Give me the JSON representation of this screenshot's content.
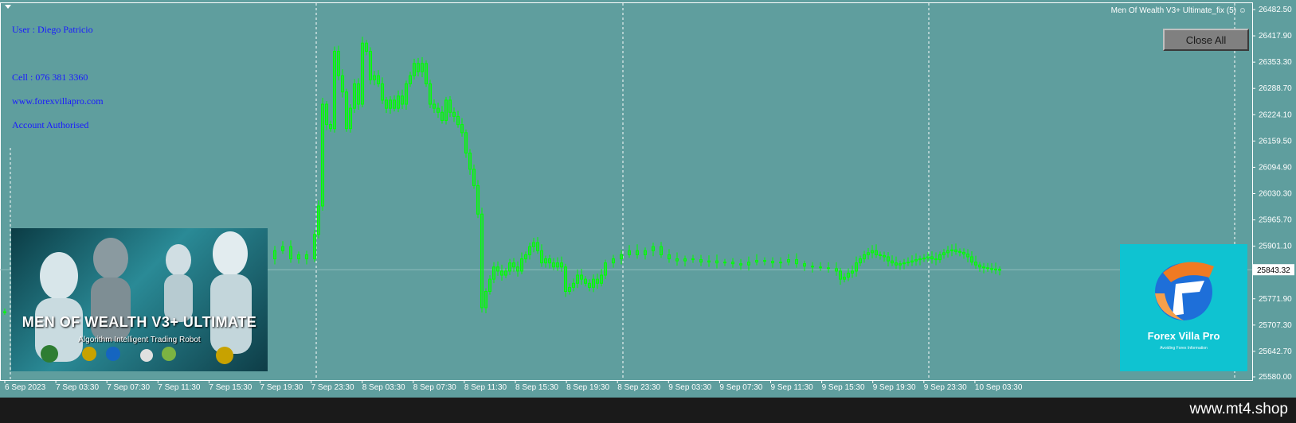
{
  "chart": {
    "ea_name": "Men Of Wealth V3+ Ultimate_fix (5)",
    "close_all_label": "Close All",
    "current_price_label": "25843.32",
    "price_labels": [
      "26482.50",
      "26417.90",
      "26353.30",
      "26288.70",
      "26224.10",
      "26159.50",
      "26094.90",
      "26030.30",
      "25965.70",
      "25901.10",
      "25771.90",
      "25707.30",
      "25642.70",
      "25580.00"
    ],
    "time_labels": [
      "6 Sep 2023",
      "7 Sep 03:30",
      "7 Sep 07:30",
      "7 Sep 11:30",
      "7 Sep 15:30",
      "7 Sep 19:30",
      "7 Sep 23:30",
      "8 Sep 03:30",
      "8 Sep 07:30",
      "8 Sep 11:30",
      "8 Sep 15:30",
      "8 Sep 19:30",
      "8 Sep 23:30",
      "9 Sep 03:30",
      "9 Sep 07:30",
      "9 Sep 11:30",
      "9 Sep 15:30",
      "9 Sep 19:30",
      "9 Sep 23:30",
      "10 Sep 03:30"
    ],
    "colors": {
      "background": "#5f9e9e",
      "candle": "#00ff00",
      "text": "#ffffff",
      "info_text": "#1a1aff"
    }
  },
  "info": {
    "user": "User : Diego Patricio",
    "cell": "Cell : 076 381 3360",
    "website": "www.forexvillapro.com",
    "account": "Account Authorised"
  },
  "banner": {
    "title": "MEN OF WEALTH V3+ ULTIMATE",
    "subtitle": "Algorithm Intelligent Trading Robot"
  },
  "logo": {
    "name": "Forex Villa Pro",
    "tagline": "Avoiding Forex Information"
  },
  "watermark": "www.mt4.shop"
}
